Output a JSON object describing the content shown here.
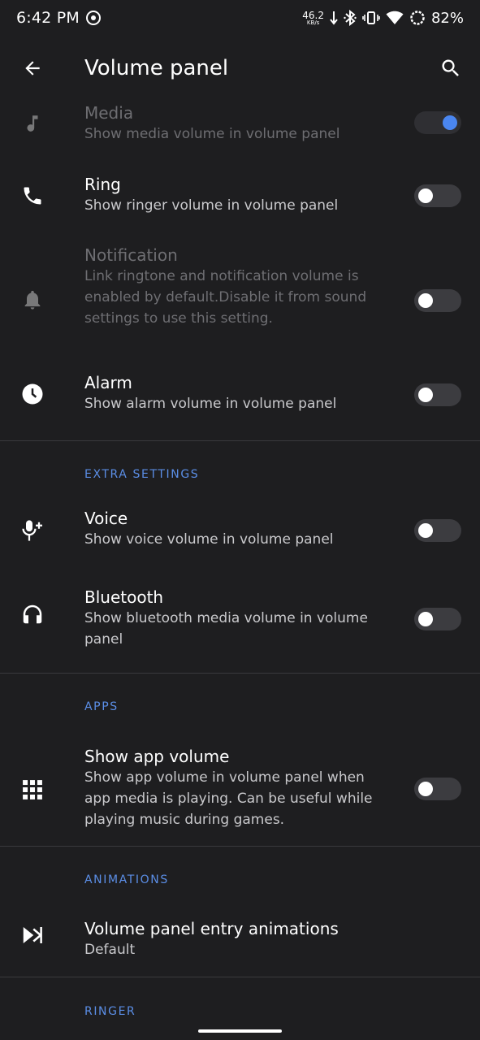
{
  "status": {
    "time": "6:42 PM",
    "net_speed": "46.2",
    "net_unit": "KB/s",
    "battery": "82%"
  },
  "appbar": {
    "title": "Volume panel",
    "back_icon": "arrow-back-icon",
    "search_icon": "search-icon"
  },
  "rows": {
    "media": {
      "title": "Media",
      "subtitle": "Show media volume in volume panel",
      "enabled": false,
      "checked": true,
      "icon": "music-note-icon"
    },
    "ring": {
      "title": "Ring",
      "subtitle": "Show ringer volume in volume panel",
      "enabled": true,
      "checked": false,
      "icon": "phone-icon"
    },
    "notification": {
      "title": "Notification",
      "subtitle": "Link ringtone and notification volume is enabled by default.Disable it from sound settings to use this setting.",
      "enabled": false,
      "checked": false,
      "icon": "bell-icon"
    },
    "alarm": {
      "title": "Alarm",
      "subtitle": "Show alarm volume in volume panel",
      "enabled": true,
      "checked": false,
      "icon": "clock-icon"
    },
    "voice": {
      "title": "Voice",
      "subtitle": "Show voice volume in volume panel",
      "enabled": true,
      "checked": false,
      "icon": "mic-plus-icon"
    },
    "bluetooth": {
      "title": "Bluetooth",
      "subtitle": "Show bluetooth media volume in volume panel",
      "enabled": true,
      "checked": false,
      "icon": "headphones-icon"
    },
    "app_volume": {
      "title": "Show app volume",
      "subtitle": "Show app volume in volume panel when app media is playing. Can be useful while playing music during games.",
      "enabled": true,
      "checked": false,
      "icon": "apps-grid-icon"
    },
    "animations": {
      "title": "Volume panel entry animations",
      "subtitle": "Default",
      "icon": "animation-icon"
    }
  },
  "sections": {
    "extra": "EXTRA SETTINGS",
    "apps": "APPS",
    "animations": "ANIMATIONS",
    "ringer": "RINGER"
  },
  "colors": {
    "background": "#1e1e20",
    "accent": "#5b8ee6",
    "toggle_on": "#4a86f0"
  }
}
